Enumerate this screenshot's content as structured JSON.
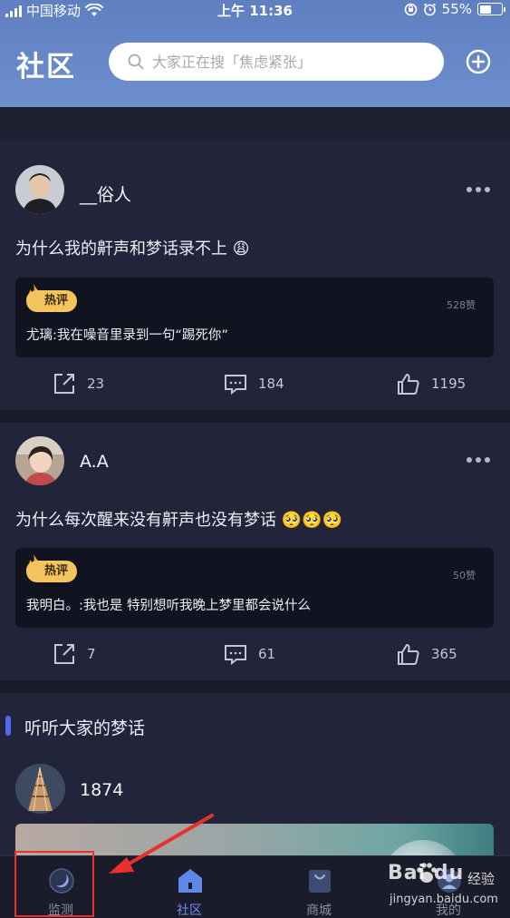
{
  "status_bar": {
    "carrier": "中国移动",
    "time": "上午 11:36",
    "battery": "55%",
    "battery_level": 0.55
  },
  "header": {
    "title": "社区",
    "search_placeholder": "大家正在搜「焦虑紧张」"
  },
  "posts": [
    {
      "username": "__俗人",
      "text": "为什么我的鼾声和梦话录不上",
      "emoji": "😩",
      "hot_label": "热评",
      "hot_likes": "528赞",
      "hot_comment": "尤璃:我在噪音里录到一句“踢死你”",
      "shares": "23",
      "comments": "184",
      "likes": "1195"
    },
    {
      "username": "A.A",
      "text": "为什么每次醒来没有鼾声也没有梦话",
      "emoji": "🥺🥺🥺",
      "hot_label": "热评",
      "hot_likes": "50赞",
      "hot_comment": "我明白。:我也是 特别想听我晚上梦里都会说什么",
      "shares": "7",
      "comments": "61",
      "likes": "365"
    }
  ],
  "section": {
    "title": "听听大家的梦话"
  },
  "dream_post": {
    "username": "1874"
  },
  "tab_bar": {
    "tabs": [
      {
        "label": "监测",
        "icon": "moon-icon"
      },
      {
        "label": "社区",
        "icon": "house-icon"
      },
      {
        "label": "商城",
        "icon": "shopping-bag-icon"
      },
      {
        "label": "我的",
        "icon": "profile-icon"
      }
    ],
    "active": "社区"
  },
  "watermark": {
    "brand": "Bai du",
    "sub": "经验",
    "url": "jingyan.baidu.com"
  },
  "colors": {
    "header_bg": "#6e8fce",
    "page_bg": "#22253a",
    "accent": "#6f8ff0",
    "hot_badge": "#f4c55c",
    "annotation_red": "#e8312a"
  }
}
